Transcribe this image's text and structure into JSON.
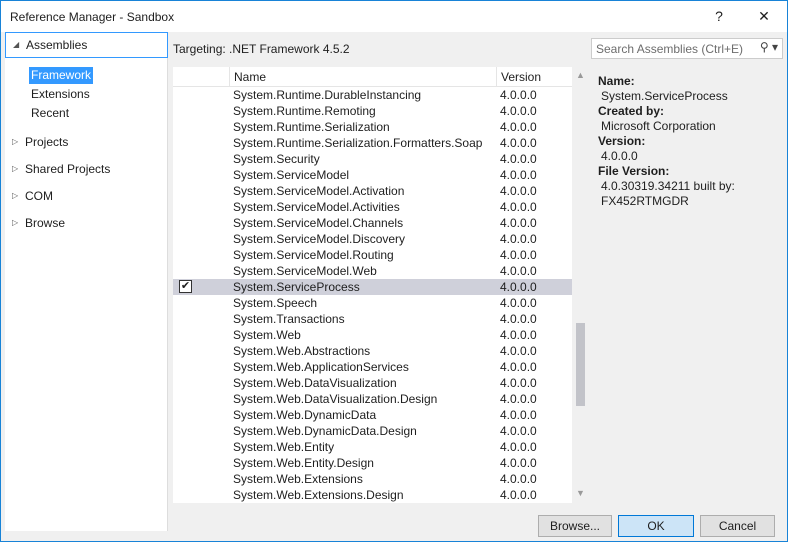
{
  "window": {
    "title": "Reference Manager - Sandbox",
    "help": "?",
    "close": "✕"
  },
  "sidebar": {
    "assemblies": "Assemblies",
    "sub_items": [
      {
        "label": "Framework",
        "selected": true
      },
      {
        "label": "Extensions"
      },
      {
        "label": "Recent"
      }
    ],
    "nodes": [
      "Projects",
      "Shared Projects",
      "COM",
      "Browse"
    ]
  },
  "targeting": "Targeting: .NET Framework 4.5.2",
  "search": {
    "placeholder": "Search Assemblies (Ctrl+E)",
    "icon": "search-icon"
  },
  "grid": {
    "columns": [
      "Name",
      "Version"
    ],
    "rows": [
      {
        "name": "System.Runtime.DurableInstancing",
        "version": "4.0.0.0"
      },
      {
        "name": "System.Runtime.Remoting",
        "version": "4.0.0.0"
      },
      {
        "name": "System.Runtime.Serialization",
        "version": "4.0.0.0"
      },
      {
        "name": "System.Runtime.Serialization.Formatters.Soap",
        "version": "4.0.0.0"
      },
      {
        "name": "System.Security",
        "version": "4.0.0.0"
      },
      {
        "name": "System.ServiceModel",
        "version": "4.0.0.0"
      },
      {
        "name": "System.ServiceModel.Activation",
        "version": "4.0.0.0"
      },
      {
        "name": "System.ServiceModel.Activities",
        "version": "4.0.0.0"
      },
      {
        "name": "System.ServiceModel.Channels",
        "version": "4.0.0.0"
      },
      {
        "name": "System.ServiceModel.Discovery",
        "version": "4.0.0.0"
      },
      {
        "name": "System.ServiceModel.Routing",
        "version": "4.0.0.0"
      },
      {
        "name": "System.ServiceModel.Web",
        "version": "4.0.0.0"
      },
      {
        "name": "System.ServiceProcess",
        "version": "4.0.0.0",
        "checked": true,
        "selected": true
      },
      {
        "name": "System.Speech",
        "version": "4.0.0.0"
      },
      {
        "name": "System.Transactions",
        "version": "4.0.0.0"
      },
      {
        "name": "System.Web",
        "version": "4.0.0.0"
      },
      {
        "name": "System.Web.Abstractions",
        "version": "4.0.0.0"
      },
      {
        "name": "System.Web.ApplicationServices",
        "version": "4.0.0.0"
      },
      {
        "name": "System.Web.DataVisualization",
        "version": "4.0.0.0"
      },
      {
        "name": "System.Web.DataVisualization.Design",
        "version": "4.0.0.0"
      },
      {
        "name": "System.Web.DynamicData",
        "version": "4.0.0.0"
      },
      {
        "name": "System.Web.DynamicData.Design",
        "version": "4.0.0.0"
      },
      {
        "name": "System.Web.Entity",
        "version": "4.0.0.0"
      },
      {
        "name": "System.Web.Entity.Design",
        "version": "4.0.0.0"
      },
      {
        "name": "System.Web.Extensions",
        "version": "4.0.0.0"
      },
      {
        "name": "System.Web.Extensions.Design",
        "version": "4.0.0.0"
      }
    ]
  },
  "details": {
    "name_label": "Name:",
    "name": "System.ServiceProcess",
    "created_label": "Created by:",
    "created": "Microsoft Corporation",
    "version_label": "Version:",
    "version": "4.0.0.0",
    "file_version_label": "File Version:",
    "file_version_1": "4.0.30319.34211 built by:",
    "file_version_2": "FX452RTMGDR"
  },
  "buttons": {
    "browse": "Browse...",
    "ok": "OK",
    "cancel": "Cancel"
  }
}
